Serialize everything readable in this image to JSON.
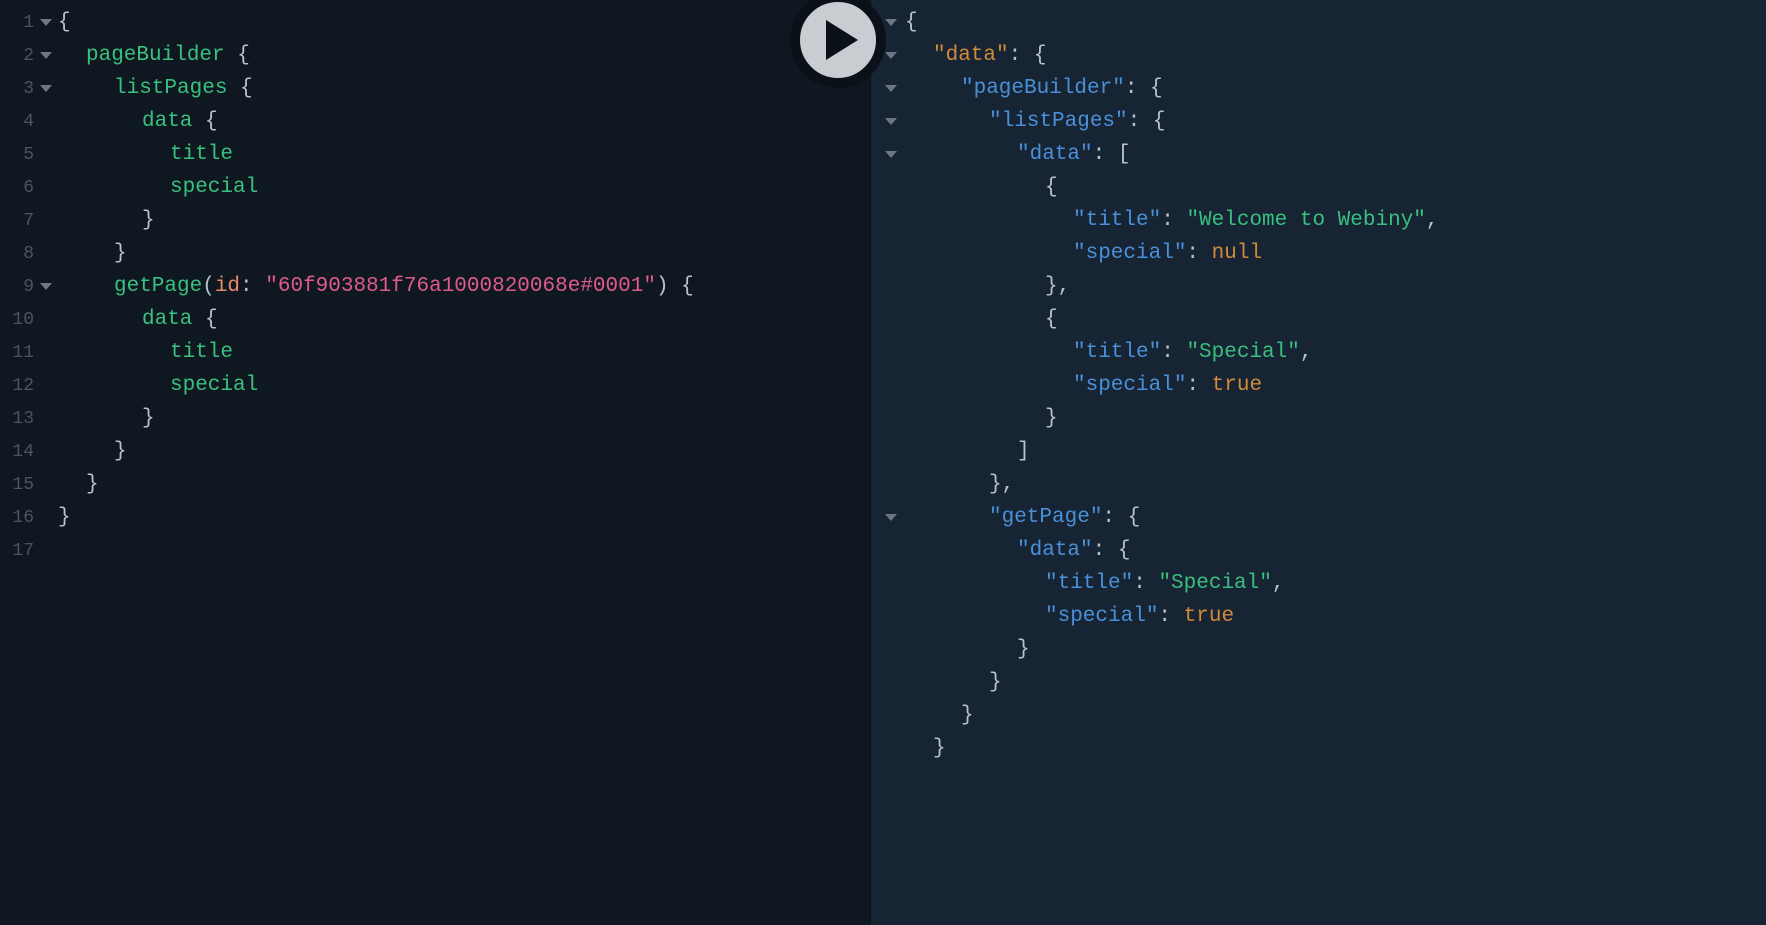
{
  "editor": {
    "leftLines": [
      {
        "n": "1",
        "fold": true,
        "tokens": [
          {
            "t": "{",
            "c": "tok-brace"
          }
        ]
      },
      {
        "n": "2",
        "fold": true,
        "tokens": [
          {
            "ind": 2
          },
          {
            "t": "pageBuilder",
            "c": "tok-field"
          },
          {
            "t": " {",
            "c": "tok-brace"
          }
        ]
      },
      {
        "n": "3",
        "fold": true,
        "tokens": [
          {
            "ind": 4
          },
          {
            "t": "listPages",
            "c": "tok-field"
          },
          {
            "t": " {",
            "c": "tok-brace"
          }
        ]
      },
      {
        "n": "4",
        "fold": false,
        "tokens": [
          {
            "ind": 6
          },
          {
            "t": "data",
            "c": "tok-field"
          },
          {
            "t": " {",
            "c": "tok-brace"
          }
        ]
      },
      {
        "n": "5",
        "fold": false,
        "tokens": [
          {
            "ind": 8
          },
          {
            "t": "title",
            "c": "tok-field"
          }
        ]
      },
      {
        "n": "6",
        "fold": false,
        "tokens": [
          {
            "ind": 8
          },
          {
            "t": "special",
            "c": "tok-field"
          }
        ]
      },
      {
        "n": "7",
        "fold": false,
        "tokens": [
          {
            "ind": 6
          },
          {
            "t": "}",
            "c": "tok-brace"
          }
        ]
      },
      {
        "n": "8",
        "fold": false,
        "tokens": [
          {
            "ind": 4
          },
          {
            "t": "}",
            "c": "tok-brace"
          }
        ]
      },
      {
        "n": "9",
        "fold": true,
        "tokens": [
          {
            "ind": 4
          },
          {
            "t": "getPage",
            "c": "tok-field"
          },
          {
            "t": "(",
            "c": "tok-brace"
          },
          {
            "t": "id",
            "c": "tok-arg"
          },
          {
            "t": ": ",
            "c": "tok-brace"
          },
          {
            "t": "\"60f903881f76a1000820068e#0001\"",
            "c": "tok-string"
          },
          {
            "t": ")",
            "c": "tok-brace"
          },
          {
            "t": " {",
            "c": "tok-brace"
          }
        ]
      },
      {
        "n": "10",
        "fold": false,
        "tokens": [
          {
            "ind": 6
          },
          {
            "t": "data",
            "c": "tok-field"
          },
          {
            "t": " {",
            "c": "tok-brace"
          }
        ]
      },
      {
        "n": "11",
        "fold": false,
        "tokens": [
          {
            "ind": 8
          },
          {
            "t": "title",
            "c": "tok-field"
          }
        ]
      },
      {
        "n": "12",
        "fold": false,
        "tokens": [
          {
            "ind": 8
          },
          {
            "t": "special",
            "c": "tok-field"
          }
        ]
      },
      {
        "n": "13",
        "fold": false,
        "tokens": [
          {
            "ind": 6
          },
          {
            "t": "}",
            "c": "tok-brace"
          }
        ]
      },
      {
        "n": "14",
        "fold": false,
        "tokens": [
          {
            "ind": 4
          },
          {
            "t": "}",
            "c": "tok-brace"
          }
        ]
      },
      {
        "n": "15",
        "fold": false,
        "tokens": [
          {
            "ind": 2
          },
          {
            "t": "}",
            "c": "tok-brace"
          }
        ]
      },
      {
        "n": "16",
        "fold": false,
        "tokens": [
          {
            "t": "}",
            "c": "tok-brace"
          }
        ]
      },
      {
        "n": "17",
        "fold": false,
        "tokens": []
      }
    ],
    "rightLines": [
      {
        "fold": true,
        "tokens": [
          {
            "t": "{",
            "c": "tok-punc"
          }
        ]
      },
      {
        "fold": true,
        "tokens": [
          {
            "ind": 2
          },
          {
            "t": "\"data\"",
            "c": "tok-key-top"
          },
          {
            "t": ": {",
            "c": "tok-punc"
          }
        ]
      },
      {
        "fold": true,
        "tokens": [
          {
            "ind": 4
          },
          {
            "t": "\"pageBuilder\"",
            "c": "tok-key"
          },
          {
            "t": ": {",
            "c": "tok-punc"
          }
        ]
      },
      {
        "fold": true,
        "tokens": [
          {
            "ind": 6
          },
          {
            "t": "\"listPages\"",
            "c": "tok-key"
          },
          {
            "t": ": {",
            "c": "tok-punc"
          }
        ]
      },
      {
        "fold": true,
        "tokens": [
          {
            "ind": 8
          },
          {
            "t": "\"data\"",
            "c": "tok-key"
          },
          {
            "t": ": [",
            "c": "tok-punc"
          }
        ]
      },
      {
        "fold": false,
        "tokens": [
          {
            "ind": 10
          },
          {
            "t": "{",
            "c": "tok-punc"
          }
        ]
      },
      {
        "fold": false,
        "tokens": [
          {
            "ind": 12
          },
          {
            "t": "\"title\"",
            "c": "tok-key"
          },
          {
            "t": ": ",
            "c": "tok-punc"
          },
          {
            "t": "\"Welcome to Webiny\"",
            "c": "tok-val-str"
          },
          {
            "t": ",",
            "c": "tok-punc"
          }
        ]
      },
      {
        "fold": false,
        "tokens": [
          {
            "ind": 12
          },
          {
            "t": "\"special\"",
            "c": "tok-key"
          },
          {
            "t": ": ",
            "c": "tok-punc"
          },
          {
            "t": "null",
            "c": "tok-val-kw"
          }
        ]
      },
      {
        "fold": false,
        "tokens": [
          {
            "ind": 10
          },
          {
            "t": "},",
            "c": "tok-punc"
          }
        ]
      },
      {
        "fold": false,
        "tokens": [
          {
            "ind": 10
          },
          {
            "t": "{",
            "c": "tok-punc"
          }
        ]
      },
      {
        "fold": false,
        "tokens": [
          {
            "ind": 12
          },
          {
            "t": "\"title\"",
            "c": "tok-key"
          },
          {
            "t": ": ",
            "c": "tok-punc"
          },
          {
            "t": "\"Special\"",
            "c": "tok-val-str"
          },
          {
            "t": ",",
            "c": "tok-punc"
          }
        ]
      },
      {
        "fold": false,
        "tokens": [
          {
            "ind": 12
          },
          {
            "t": "\"special\"",
            "c": "tok-key"
          },
          {
            "t": ": ",
            "c": "tok-punc"
          },
          {
            "t": "true",
            "c": "tok-val-kw"
          }
        ]
      },
      {
        "fold": false,
        "tokens": [
          {
            "ind": 10
          },
          {
            "t": "}",
            "c": "tok-punc"
          }
        ]
      },
      {
        "fold": false,
        "tokens": [
          {
            "ind": 8
          },
          {
            "t": "]",
            "c": "tok-punc"
          }
        ]
      },
      {
        "fold": false,
        "tokens": [
          {
            "ind": 6
          },
          {
            "t": "},",
            "c": "tok-punc"
          }
        ]
      },
      {
        "fold": true,
        "tokens": [
          {
            "ind": 6
          },
          {
            "t": "\"getPage\"",
            "c": "tok-key"
          },
          {
            "t": ": {",
            "c": "tok-punc"
          }
        ]
      },
      {
        "fold": false,
        "tokens": [
          {
            "ind": 8
          },
          {
            "t": "\"data\"",
            "c": "tok-key"
          },
          {
            "t": ": {",
            "c": "tok-punc"
          }
        ]
      },
      {
        "fold": false,
        "tokens": [
          {
            "ind": 10
          },
          {
            "t": "\"title\"",
            "c": "tok-key"
          },
          {
            "t": ": ",
            "c": "tok-punc"
          },
          {
            "t": "\"Special\"",
            "c": "tok-val-str"
          },
          {
            "t": ",",
            "c": "tok-punc"
          }
        ]
      },
      {
        "fold": false,
        "tokens": [
          {
            "ind": 10
          },
          {
            "t": "\"special\"",
            "c": "tok-key"
          },
          {
            "t": ": ",
            "c": "tok-punc"
          },
          {
            "t": "true",
            "c": "tok-val-kw"
          }
        ]
      },
      {
        "fold": false,
        "tokens": [
          {
            "ind": 8
          },
          {
            "t": "}",
            "c": "tok-punc"
          }
        ]
      },
      {
        "fold": false,
        "tokens": [
          {
            "ind": 6
          },
          {
            "t": "}",
            "c": "tok-punc"
          }
        ]
      },
      {
        "fold": false,
        "tokens": [
          {
            "ind": 4
          },
          {
            "t": "}",
            "c": "tok-punc"
          }
        ]
      },
      {
        "fold": false,
        "tokens": [
          {
            "ind": 2
          },
          {
            "t": "}",
            "c": "tok-punc"
          }
        ]
      }
    ]
  }
}
